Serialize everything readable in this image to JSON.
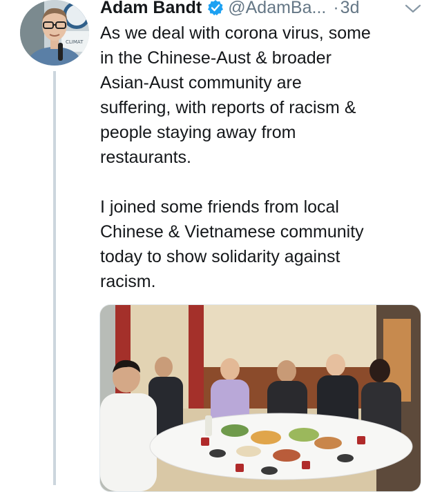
{
  "tweet": {
    "author_name": "Adam Bandt",
    "handle": "@AdamBa...",
    "separator": "·",
    "time": "3d",
    "paragraphs": [
      "As we deal with corona virus, some\nin the Chinese-Aust & broader\nAsian-Aust community are\nsuffering, with reports of racism &\npeople staying away from\nrestaurants.",
      "I joined some friends from local\nChinese & Vietnamese community\ntoday to show solidarity against\nracism."
    ],
    "avatar_sign_text": "CLIMAT"
  },
  "icons": {
    "verified": "verified-badge-icon",
    "more": "chevron-down-icon"
  },
  "colors": {
    "text": "#14171a",
    "secondary": "#657786",
    "verified": "#1da1f2",
    "thread_line": "#ccd6dd"
  }
}
